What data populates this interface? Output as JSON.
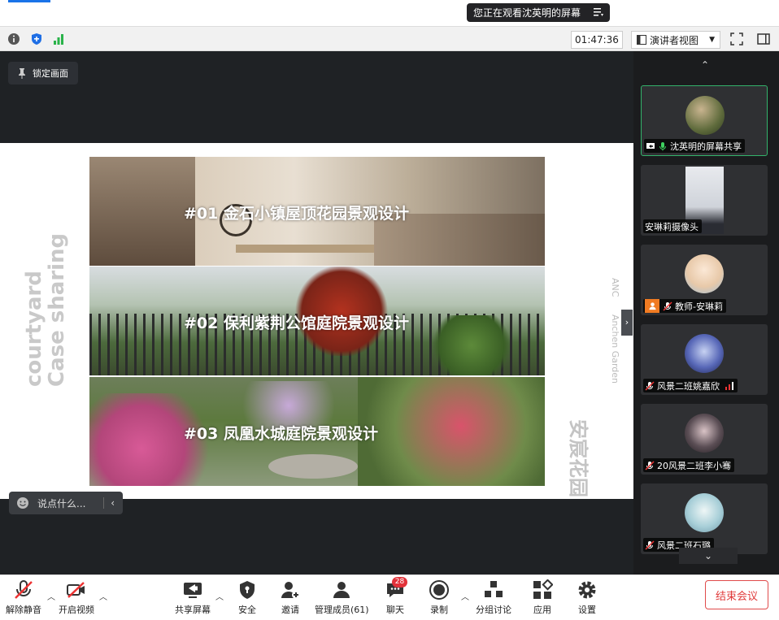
{
  "top": {
    "viewing_text": "您正在观看沈英明的屏幕"
  },
  "infobar": {
    "timer": "01:47:36",
    "view_mode": "演讲者视图"
  },
  "stage": {
    "lock_label": "锁定画面",
    "chat_placeholder": "说点什么...",
    "slide": {
      "left_vertical_line1": "courtyard",
      "left_vertical_line2": "Case sharing",
      "right_vertical_line1": "安宸花园",
      "right_vertical_line2": "Anchen Garden",
      "right_vertical_mark": "ANC",
      "items": [
        {
          "title": "#01  金石小镇屋顶花园景观设计"
        },
        {
          "title": "#02  保利紫荆公馆庭院景观设计"
        },
        {
          "title": "#03  凤凰水城庭院景观设计"
        }
      ]
    }
  },
  "participants": [
    {
      "label": "沈英明的屏幕共享",
      "active": true,
      "icon": "mic-on-icon"
    },
    {
      "label": "安琳莉摄像头",
      "icon": "none"
    },
    {
      "label": "教师-安琳莉",
      "icon": "mic-muted-icon",
      "host": true
    },
    {
      "label": "风景二班姚嘉欣",
      "icon": "mic-muted-icon",
      "signal": true
    },
    {
      "label": "20风景二班李小骞",
      "icon": "mic-muted-icon"
    },
    {
      "label": "风景二班石璐",
      "icon": "mic-muted-icon"
    }
  ],
  "toolbar": {
    "unmute": "解除静音",
    "start_video": "开启视频",
    "share_screen": "共享屏幕",
    "security": "安全",
    "invite": "邀请",
    "manage_members": "管理成员(61)",
    "chat": "聊天",
    "chat_badge": "28",
    "record": "录制",
    "breakout": "分组讨论",
    "apps": "应用",
    "settings": "设置",
    "end_meeting": "结束会议"
  },
  "colors": {
    "accent_green": "#33b36b",
    "end_red": "#e03a3a",
    "stage_bg": "#1f2225"
  }
}
